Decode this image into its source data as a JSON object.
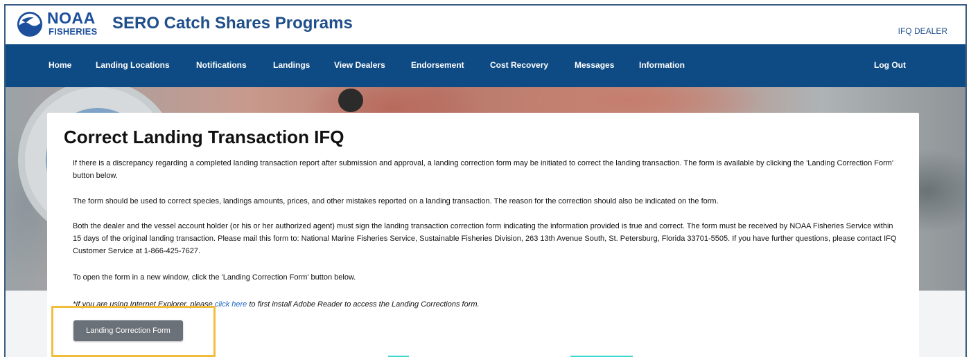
{
  "header": {
    "logo_primary": "NOAA",
    "logo_secondary": "FISHERIES",
    "site_title": "SERO Catch Shares Programs",
    "user_role": "IFQ DEALER"
  },
  "nav": {
    "items": [
      {
        "label": "Home"
      },
      {
        "label": "Landing Locations"
      },
      {
        "label": "Notifications"
      },
      {
        "label": "Landings"
      },
      {
        "label": "View Dealers"
      },
      {
        "label": "Endorsement"
      },
      {
        "label": "Cost Recovery"
      },
      {
        "label": "Messages"
      },
      {
        "label": "Information"
      }
    ],
    "logout_label": "Log Out"
  },
  "main": {
    "title": "Correct Landing Transaction IFQ",
    "para1": "If there is a discrepancy regarding a completed landing transaction report after submission and approval, a landing correction form may be initiated to correct the landing transaction. The form is available by clicking the 'Landing Correction Form' button below.",
    "para2": "The form should be used to correct species, landings amounts, prices, and other mistakes reported on a landing transaction. The reason for the correction should also be indicated on the form.",
    "para3": "Both the dealer and the vessel account holder (or his or her authorized agent) must sign the landing transaction correction form indicating the information provided is true and correct. The form must be received by NOAA Fisheries Service within 15 days of the original landing transaction. Please mail this form to: National Marine Fisheries Service, Sustainable Fisheries Division, 263 13th Avenue South, St. Petersburg, Florida 33701-5505. If you have further questions, please contact IFQ Customer Service at 1-866-425-7627.",
    "para4": "To open the form in a new window, click the 'Landing Correction Form' button below.",
    "ie_note_prefix": "*If you are using Internet Explorer, please ",
    "ie_note_link": "click here",
    "ie_note_suffix": " to first install Adobe Reader to access the Landing Corrections form.",
    "button_label": "Landing Correction Form"
  },
  "colors": {
    "nav_background": "#0e4a83",
    "title_blue": "#1f4f8a",
    "button_gray": "#6b7178",
    "highlight": "#f2bd3c",
    "link": "#1a66c9"
  }
}
